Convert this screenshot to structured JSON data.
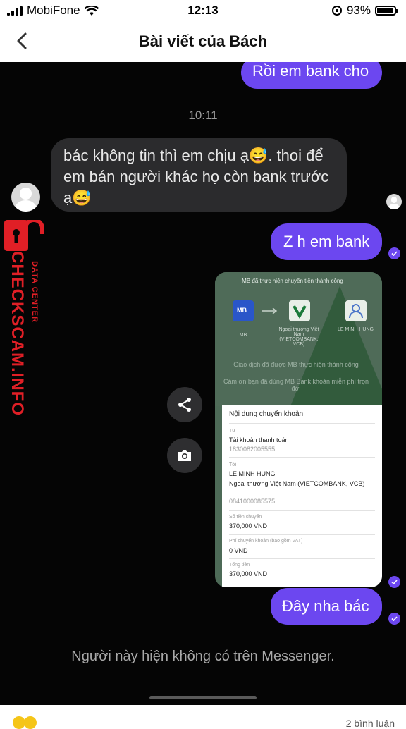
{
  "status": {
    "carrier": "MobiFone",
    "time": "12:13",
    "battery": "93%",
    "battery_level": 0.93
  },
  "header": {
    "title": "Bài viết của Bách"
  },
  "chat": {
    "msg_top": "Rồi em bank cho",
    "timestamp": "10:11",
    "msg_them": "bác không tin thì em chịu ạ😅. thoi để em bán người khác họ còn bank trước ạ😅",
    "msg_zh": "Z h em bank",
    "msg_last": "Đây nha bác",
    "notice": "Người này hiện không có trên Messenger."
  },
  "receipt": {
    "header": "MB đã thực hiện chuyển tiền thành công",
    "bank_from": "MB",
    "bank_from_label": "MB",
    "bank_to_label": "Ngoại thương Việt Nam (VIETCOMBANK, VCB)",
    "recipient_label": "LE MINH HUNG",
    "dim1": "Giao dịch đã được MB thực hiện thành công",
    "dim2": "Cảm ơn bạn đã dùng MB Bank khoản miễn phí trọn đời",
    "card_title": "Nội dung chuyển khoản",
    "from_label": "Từ",
    "from_value": "Tài khoản thanh toán",
    "from_number": "1830082005555",
    "to_label": "Tới",
    "to_name": "LE MINH HUNG",
    "to_bank": "Ngoai thương Việt Nam (VIETCOMBANK, VCB)",
    "to_number": "0841000085575",
    "amount_label": "Số tiền chuyển",
    "amount": "370,000 VND",
    "fee_label": "Phí chuyển khoản (bao gồm VAT)",
    "fee": "0 VND",
    "total_label": "Tổng tiền",
    "total": "370,000 VND"
  },
  "watermark": {
    "main": "CHECKSCAM.INFO",
    "sub": "DATA CENTER"
  },
  "footer": {
    "right": "2 bình luận"
  },
  "colors": {
    "accent": "#6c47f0",
    "them_bubble": "#2b2b2d",
    "chat_bg": "#050505",
    "watermark": "#e01f26"
  },
  "icons": [
    "back-chevron-icon",
    "wifi-icon",
    "share-icon",
    "camera-icon",
    "lock-icon",
    "seen-check-icon"
  ]
}
